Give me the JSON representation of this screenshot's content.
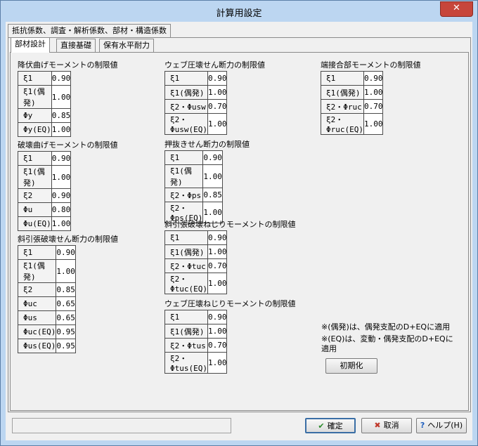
{
  "window": {
    "title": "計算用設定",
    "close_glyph": "✕"
  },
  "outer_tab": {
    "label": "抵抗係数、調査・解析係数、部材・構造係数"
  },
  "inner_tabs": [
    {
      "label": "部材設計"
    },
    {
      "label": "直接基礎"
    },
    {
      "label": "保有水平耐力"
    }
  ],
  "sections": {
    "kofuku": {
      "title": "降伏曲げモーメントの制限値",
      "rows": [
        {
          "label": "ξ1",
          "value": "0.90"
        },
        {
          "label": "ξ1(偶発)",
          "value": "1.00"
        },
        {
          "label": "Φy",
          "value": "0.85"
        },
        {
          "label": "Φy(EQ)",
          "value": "1.00"
        }
      ]
    },
    "hakai": {
      "title": "破壊曲げモーメントの制限値",
      "rows": [
        {
          "label": "ξ1",
          "value": "0.90"
        },
        {
          "label": "ξ1(偶発)",
          "value": "1.00"
        },
        {
          "label": "ξ2",
          "value": "0.90"
        },
        {
          "label": "Φu",
          "value": "0.80"
        },
        {
          "label": "Φu(EQ)",
          "value": "1.00"
        }
      ]
    },
    "shahiki": {
      "title": "斜引張破壊せん断力の制限値",
      "rows": [
        {
          "label": "ξ1",
          "value": "0.90"
        },
        {
          "label": "ξ1(偶発)",
          "value": "1.00"
        },
        {
          "label": "ξ2",
          "value": "0.85"
        },
        {
          "label": "Φuc",
          "value": "0.65"
        },
        {
          "label": "Φus",
          "value": "0.65"
        },
        {
          "label": "Φuc(EQ)",
          "value": "0.95"
        },
        {
          "label": "Φus(EQ)",
          "value": "0.95"
        }
      ]
    },
    "web_sendan": {
      "title": "ウェブ圧壊せん断力の制限値",
      "rows": [
        {
          "label": "ξ1",
          "value": "0.90"
        },
        {
          "label": "ξ1(偶発)",
          "value": "1.00"
        },
        {
          "label": "ξ2・Φusw",
          "value": "0.70"
        },
        {
          "label": "ξ2・Φusw(EQ)",
          "value": "1.00"
        }
      ]
    },
    "oshinuki": {
      "title": "押抜きせん断力の制限値",
      "rows": [
        {
          "label": "ξ1",
          "value": "0.90"
        },
        {
          "label": "ξ1(偶発)",
          "value": "1.00"
        },
        {
          "label": "ξ2・Φps",
          "value": "0.85"
        },
        {
          "label": "ξ2・Φps(EQ)",
          "value": "1.00"
        }
      ]
    },
    "shahiki_nejiri": {
      "title": "斜引張破壊ねじりモーメントの制限値",
      "rows": [
        {
          "label": "ξ1",
          "value": "0.90"
        },
        {
          "label": "ξ1(偶発)",
          "value": "1.00"
        },
        {
          "label": "ξ2・Φtuc",
          "value": "0.70"
        },
        {
          "label": "ξ2・Φtuc(EQ)",
          "value": "1.00"
        }
      ]
    },
    "web_nejiri": {
      "title": "ウェブ圧壊ねじりモーメントの制限値",
      "rows": [
        {
          "label": "ξ1",
          "value": "0.90"
        },
        {
          "label": "ξ1(偶発)",
          "value": "1.00"
        },
        {
          "label": "ξ2・Φtus",
          "value": "0.70"
        },
        {
          "label": "ξ2・Φtus(EQ)",
          "value": "1.00"
        }
      ]
    },
    "tansetsugo": {
      "title": "端接合部モーメントの制限値",
      "rows": [
        {
          "label": "ξ1",
          "value": "0.90"
        },
        {
          "label": "ξ1(偶発)",
          "value": "1.00"
        },
        {
          "label": "ξ2・Φruc",
          "value": "0.70"
        },
        {
          "label": "ξ2・Φruc(EQ)",
          "value": "1.00"
        }
      ]
    }
  },
  "notes": {
    "line1": "※(偶発)は、偶発支配のD+EQに適用",
    "line2a": "※(EQ)は、変動・偶発支配のD+EQに",
    "line2b": "適用"
  },
  "buttons": {
    "init": "初期化",
    "ok": "確定",
    "cancel": "取消",
    "help": "ヘルプ(H)"
  },
  "status_text": "",
  "colors": {
    "ok_check": "#2a8a2a",
    "cancel_x": "#c0392b",
    "help_q": "#1f5fbf",
    "close_bg": "#c7463b"
  }
}
